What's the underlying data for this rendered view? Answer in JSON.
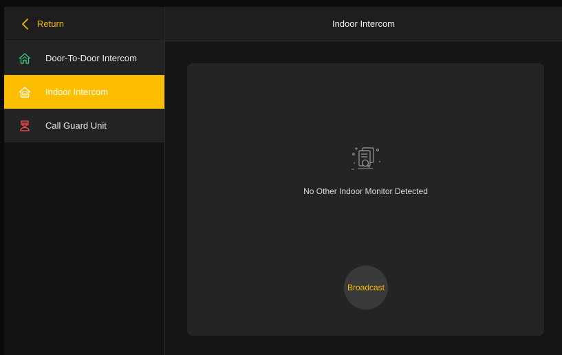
{
  "sidebar": {
    "return_label": "Return",
    "items": [
      {
        "label": "Door-To-Door Intercom",
        "icon": "house-icon",
        "active": false
      },
      {
        "label": "Indoor Intercom",
        "icon": "indoor-monitor-icon",
        "active": true
      },
      {
        "label": "Call Guard Unit",
        "icon": "guard-icon",
        "active": false
      }
    ]
  },
  "header": {
    "title": "Indoor Intercom"
  },
  "main": {
    "empty_icon": "document-search-icon",
    "empty_message": "No Other Indoor Monitor Detected",
    "broadcast_label": "Broadcast"
  },
  "colors": {
    "accent": "#fdbd00",
    "accent_text": "#f5b800",
    "door_icon": "#3ec27a",
    "guard_icon": "#ff4d4d",
    "background": "#151515",
    "panel": "#242424"
  }
}
